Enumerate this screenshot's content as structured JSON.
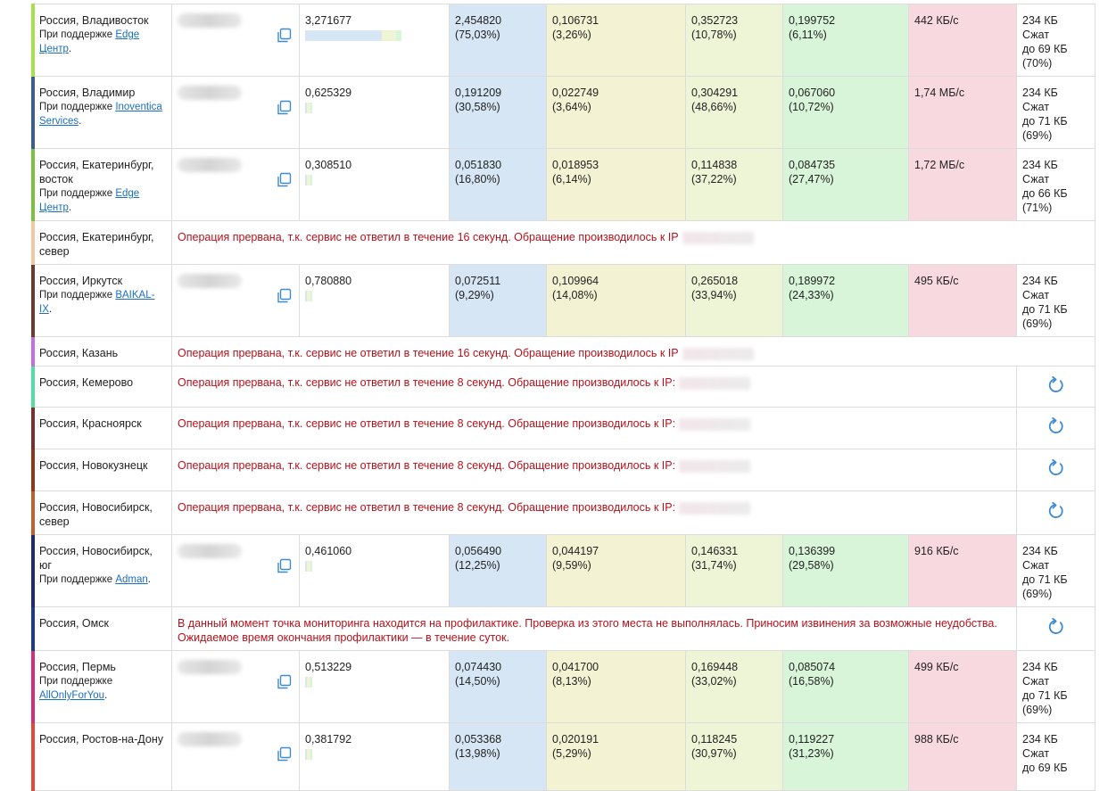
{
  "colors": {
    "error": "#b5121b",
    "link": "#1a6fc2",
    "blue": "#d6e6f4",
    "yellow": "#f3f3d4",
    "lime": "#eef4d6",
    "green": "#d9f5d9",
    "pink": "#f8d9df",
    "icon": "#3d8ad1"
  },
  "icons": {
    "copy": "copy-icon",
    "refresh": "refresh-icon"
  },
  "rows": [
    {
      "kind": "ok",
      "city": "Россия, Владивосток",
      "support_prefix": "При поддержке ",
      "sponsor": "Edge Центр",
      "support_suffix": ".",
      "accent": "#a6e04a",
      "total": "3,271677",
      "bar": [
        0.7503,
        0.0326,
        0.1078,
        0.0611
      ],
      "c1": "2,454820",
      "c1p": "(75,03%)",
      "c2": "0,106731",
      "c2p": "(3,26%)",
      "c3": "0,352723",
      "c3p": "(10,78%)",
      "c4": "0,199752",
      "c4p": "(6,11%)",
      "speed": "442 КБ/с",
      "s1": "234 КБ",
      "s2": "Сжат",
      "s3": "до 69 КБ",
      "s4": "(70%)",
      "h": 76
    },
    {
      "kind": "ok",
      "city": "Россия, Владимир",
      "support_prefix": "При поддержке ",
      "sponsor": "Inoventica Services",
      "support_suffix": ".",
      "accent": "#3b5d91",
      "total": "0,625329",
      "bar": [
        0.3058,
        0.0364,
        0.4866,
        0.1072
      ],
      "c1": "0,191209",
      "c1p": "(30,58%)",
      "c2": "0,022749",
      "c2p": "(3,64%)",
      "c3": "0,304291",
      "c3p": "(48,66%)",
      "c4": "0,067060",
      "c4p": "(10,72%)",
      "speed": "1,74 МБ/с",
      "s1": "234 КБ",
      "s2": "Сжат",
      "s3": "до 71 КБ",
      "s4": "(69%)",
      "h": 76
    },
    {
      "kind": "ok",
      "city": "Россия, Екатеринбург, восток",
      "support_prefix": "При поддержке ",
      "sponsor": "Edge Центр",
      "support_suffix": ".",
      "accent": "#7ac142",
      "total": "0,308510",
      "bar": [
        0.168,
        0.0614,
        0.3722,
        0.2747
      ],
      "c1": "0,051830",
      "c1p": "(16,80%)",
      "c2": "0,018953",
      "c2p": "(6,14%)",
      "c3": "0,114838",
      "c3p": "(37,22%)",
      "c4": "0,084735",
      "c4p": "(27,47%)",
      "speed": "1,72 МБ/с",
      "s1": "234 КБ",
      "s2": "Сжат",
      "s3": "до 66 КБ",
      "s4": "(71%)",
      "h": 76
    },
    {
      "kind": "err",
      "city": "Россия, Екатеринбург, север",
      "accent": "#f0c9a0",
      "msg": "Операция прервана, т.к. сервис не ответил в течение 16 секунд. Обращение производилось к IP",
      "refresh": false,
      "h": 45
    },
    {
      "kind": "ok",
      "city": "Россия, Иркутск",
      "support_prefix": "При поддержке ",
      "sponsor": "BAIKAL-IX",
      "support_suffix": ".",
      "accent": "#6b3b2e",
      "total": "0,780880",
      "bar": [
        0.0929,
        0.1408,
        0.3394,
        0.2433
      ],
      "c1": "0,072511",
      "c1p": "(9,29%)",
      "c2": "0,109964",
      "c2p": "(14,08%)",
      "c3": "0,265018",
      "c3p": "(33,94%)",
      "c4": "0,189972",
      "c4p": "(24,33%)",
      "speed": "495 КБ/с",
      "s1": "234 КБ",
      "s2": "Сжат",
      "s3": "до 71 КБ",
      "s4": "(69%)",
      "h": 76
    },
    {
      "kind": "err",
      "city": "Россия, Казань",
      "accent": "#c46fe0",
      "msg": "Операция прервана, т.к. сервис не ответил в течение 16 секунд. Обращение производилось к IP",
      "refresh": false,
      "h": 29
    },
    {
      "kind": "err",
      "city": "Россия, Кемерово",
      "accent": "#4fe0a0",
      "msg": "Операция прервана, т.к. сервис не ответил в течение 8 секунд. Обращение производилось к IP:",
      "refresh": true,
      "h": 46
    },
    {
      "kind": "err",
      "city": "Россия, Красноярск",
      "accent": "#7a2e2e",
      "msg": "Операция прервана, т.к. сервис не ответил в течение 8 секунд. Обращение производилось к IP:",
      "refresh": true,
      "h": 47
    },
    {
      "kind": "err",
      "city": "Россия, Новокузнецк",
      "accent": "#8a3a1a",
      "msg": "Операция прервана, т.к. сервис не ответил в течение 8 секунд. Обращение производилось к IP:",
      "refresh": true,
      "h": 47
    },
    {
      "kind": "err",
      "city": "Россия, Новосибирск, север",
      "accent": "#c0602e",
      "msg": "Операция прервана, т.к. сервис не ответил в течение 8 секунд. Обращение производилось к IP:",
      "refresh": true,
      "h": 47
    },
    {
      "kind": "ok",
      "city": "Россия, Новосибирск, юг",
      "support_prefix": "При поддержке ",
      "sponsor": "Adman",
      "support_suffix": ".",
      "accent": "#1f2a6e",
      "total": "0,461060",
      "bar": [
        0.1225,
        0.0959,
        0.3174,
        0.2958
      ],
      "c1": "0,056490",
      "c1p": "(12,25%)",
      "c2": "0,044197",
      "c2p": "(9,59%)",
      "c3": "0,146331",
      "c3p": "(31,74%)",
      "c4": "0,136399",
      "c4p": "(29,58%)",
      "speed": "916 КБ/с",
      "s1": "234 КБ",
      "s2": "Сжат",
      "s3": "до 71 КБ",
      "s4": "(69%)",
      "h": 76
    },
    {
      "kind": "maint",
      "city": "Россия, Омск",
      "accent": "#1f3a8a",
      "msg": "В данный момент точка мониторинга находится на профилактике. Проверка из этого места не выполнялась. Приносим извинения за возможные неудобства. Ожидаемое время окончания профилактики — в течение суток.",
      "refresh": true,
      "h": 46
    },
    {
      "kind": "ok",
      "city": "Россия, Пермь",
      "support_prefix": "При поддержке ",
      "sponsor": "AllOnlyForYou",
      "support_suffix": ".",
      "accent": "#d0307a",
      "total": "0,513229",
      "bar": [
        0.145,
        0.0813,
        0.3302,
        0.1658
      ],
      "c1": "0,074430",
      "c1p": "(14,50%)",
      "c2": "0,041700",
      "c2p": "(8,13%)",
      "c3": "0,169448",
      "c3p": "(33,02%)",
      "c4": "0,085074",
      "c4p": "(16,58%)",
      "speed": "499 КБ/с",
      "s1": "234 КБ",
      "s2": "Сжат",
      "s3": "до 71 КБ",
      "s4": "(69%)",
      "h": 76
    },
    {
      "kind": "ok",
      "city": "Россия, Ростов-на-Дону",
      "support_prefix": "",
      "sponsor": "",
      "support_suffix": "",
      "accent": "#e04a3a",
      "total": "0,381792",
      "bar": [
        0.1398,
        0.0529,
        0.3097,
        0.3123
      ],
      "c1": "0,053368",
      "c1p": "(13,98%)",
      "c2": "0,020191",
      "c2p": "(5,29%)",
      "c3": "0,118245",
      "c3p": "(30,97%)",
      "c4": "0,119227",
      "c4p": "(31,23%)",
      "speed": "988 КБ/с",
      "s1": "234 КБ",
      "s2": "Сжат",
      "s3": "до 69 КБ",
      "s4": "",
      "h": 76
    }
  ]
}
